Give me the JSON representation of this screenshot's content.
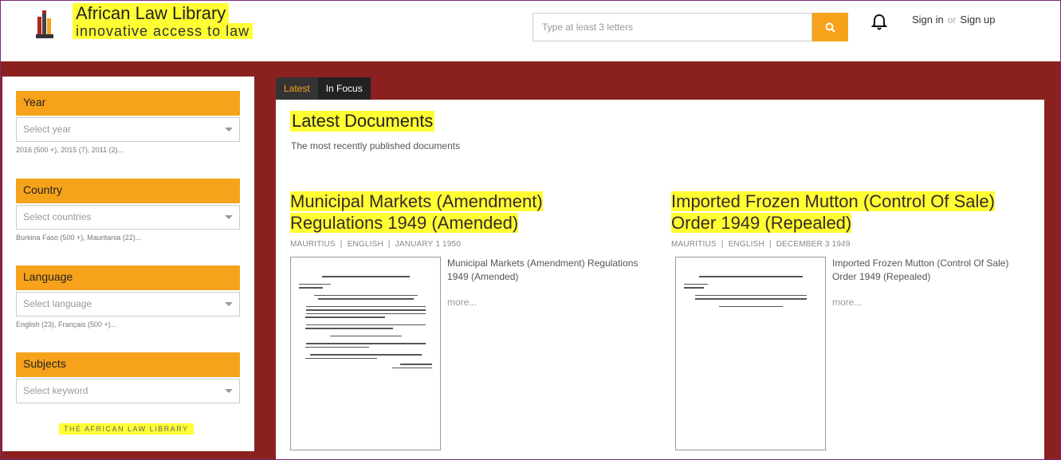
{
  "header": {
    "title": "African Law Library",
    "subtitle": "innovative access to law",
    "search_placeholder": "Type at least 3 letters",
    "sign_in": "Sign in",
    "or": "or",
    "sign_up": "Sign up",
    "accent_color": "#f7a21b",
    "highlight_color": "#ffff33"
  },
  "sidebar": {
    "filters": [
      {
        "label": "Year",
        "placeholder": "Select year",
        "counts": "2016 (500 +), 2015 (7), 2011 (2)..."
      },
      {
        "label": "Country",
        "placeholder": "Select countries",
        "counts": "Burkina Faso (500 +), Mauritania (22)..."
      },
      {
        "label": "Language",
        "placeholder": "Select language",
        "counts": "English (23), Français (500 +)..."
      },
      {
        "label": "Subjects",
        "placeholder": "Select keyword",
        "counts": ""
      }
    ],
    "footer": "THE AFRICAN LAW LIBRARY"
  },
  "tabs": [
    {
      "label": "Latest",
      "active": true
    },
    {
      "label": "In Focus",
      "active": false
    }
  ],
  "main": {
    "title": "Latest Documents",
    "description": "The most recently published documents",
    "documents": [
      {
        "title_line1": "Municipal Markets (Amendment)",
        "title_line2": "Regulations 1949 (Amended)",
        "country": "MAURITIUS",
        "language": "ENGLISH",
        "date": "JANUARY 1 1950",
        "summary": "Municipal Markets (Amendment) Regulations 1949 (Amended)",
        "more": "more..."
      },
      {
        "title_line1": "Imported Frozen Mutton (Control Of Sale)",
        "title_line2": "Order 1949 (Repealed)",
        "country": "MAURITIUS",
        "language": "ENGLISH",
        "date": "DECEMBER 3 1949",
        "summary": "Imported Frozen Mutton (Control Of Sale) Order 1949 (Repealed)",
        "more": "more..."
      }
    ],
    "meta_separator": "|"
  }
}
